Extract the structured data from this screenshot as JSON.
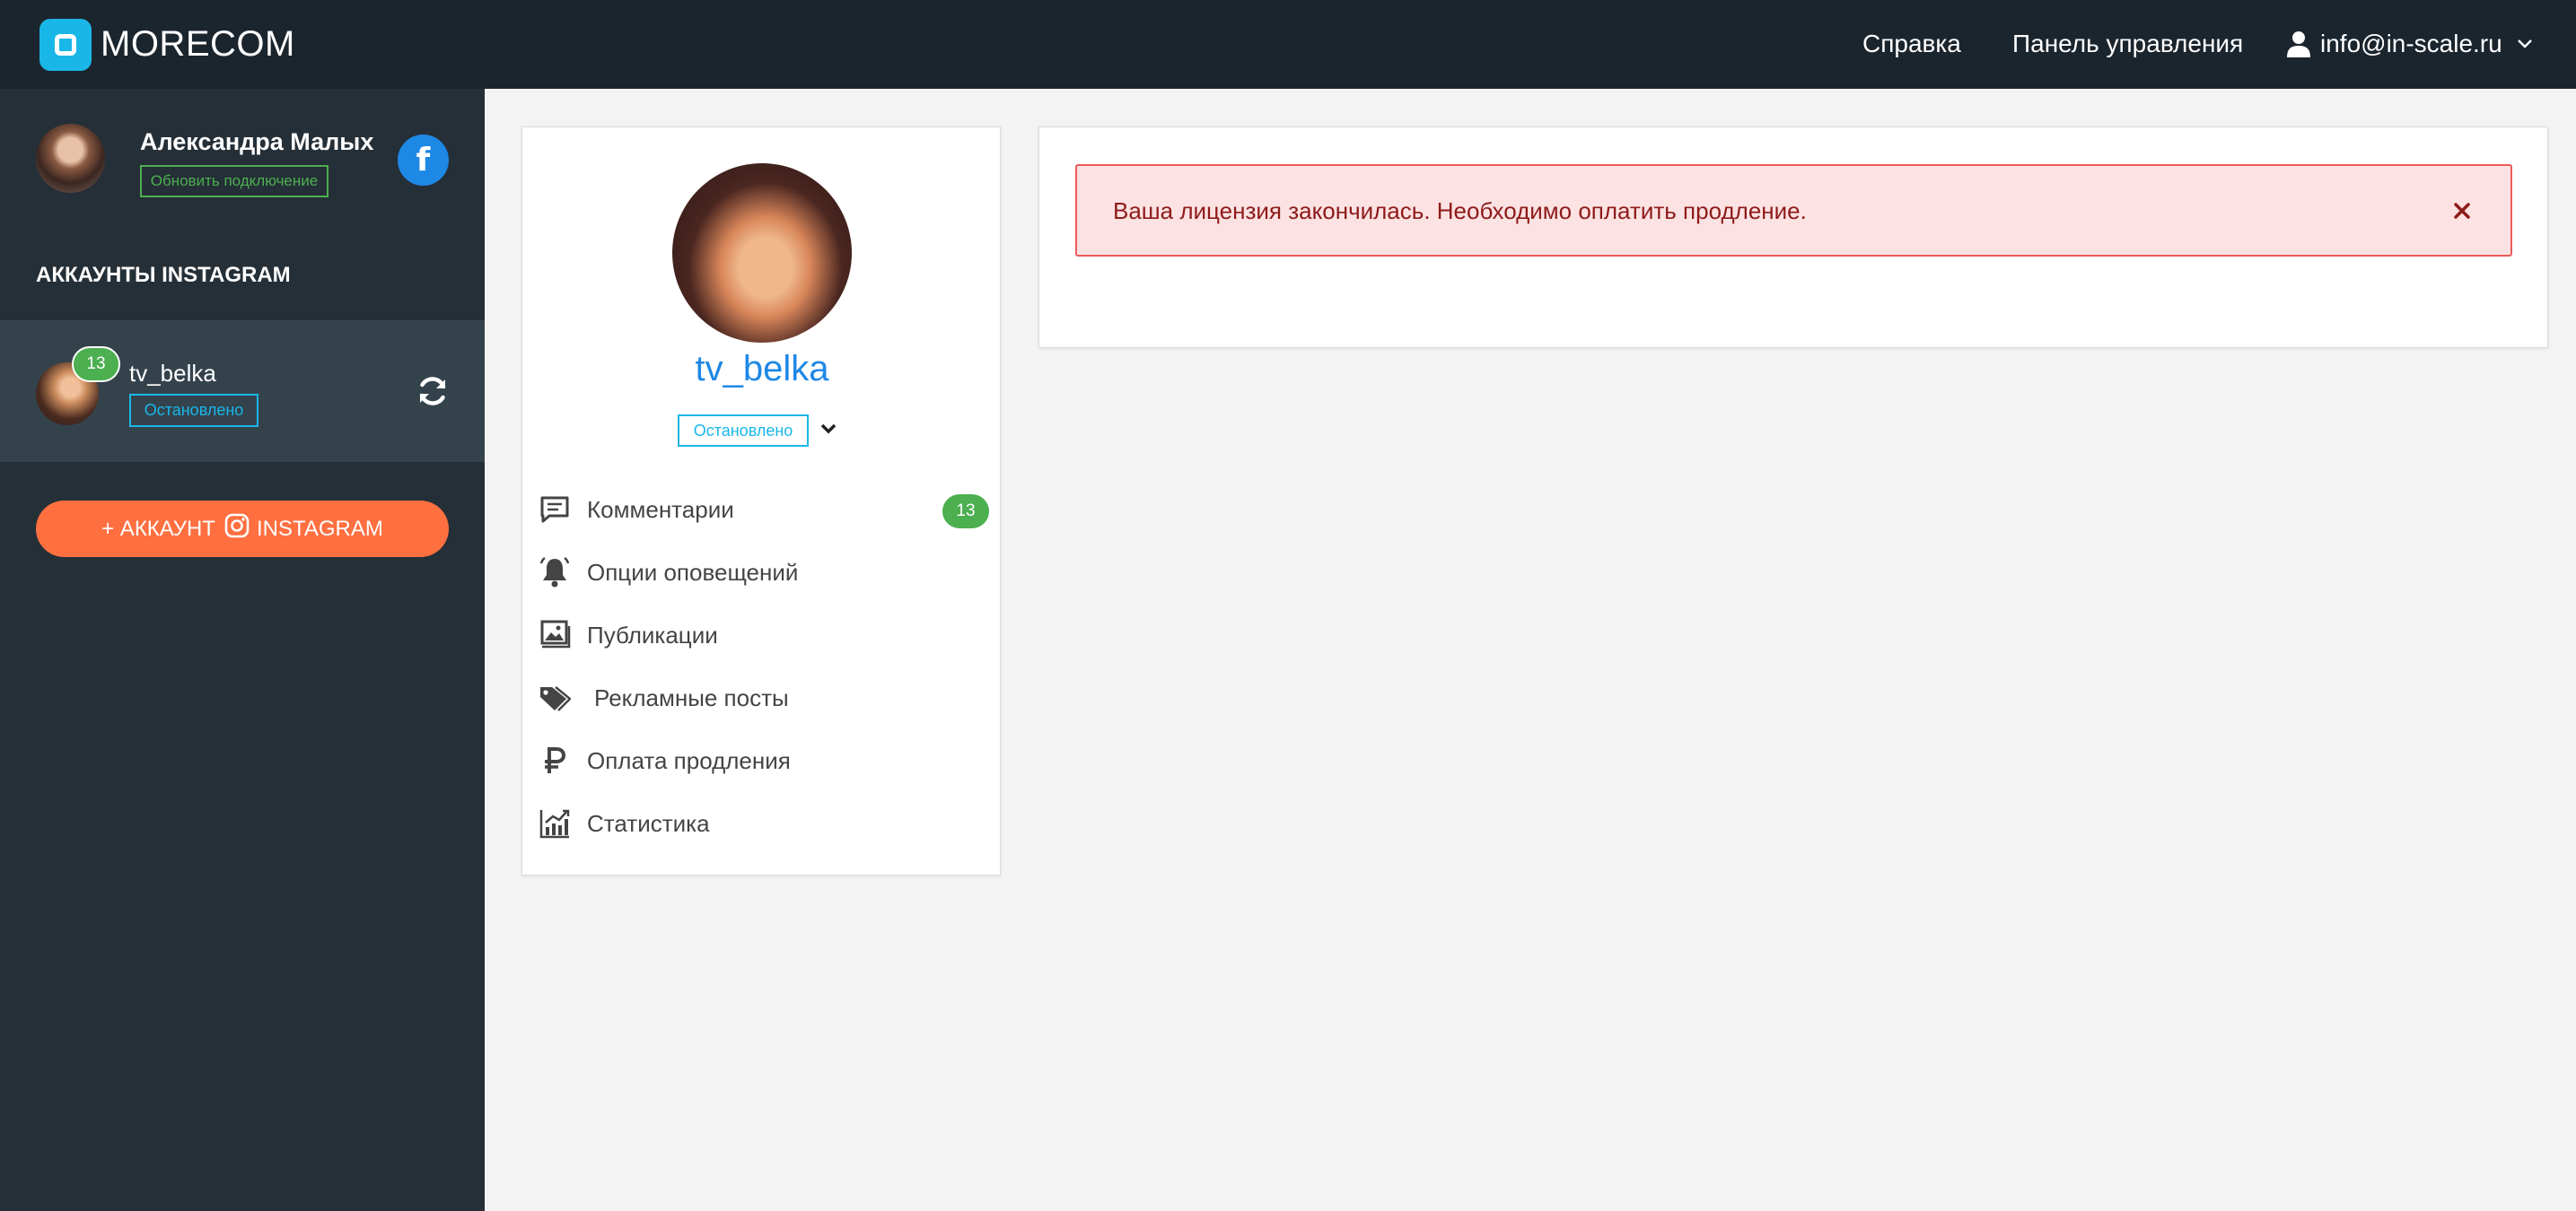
{
  "brand": {
    "name": "MORECOM"
  },
  "topnav": {
    "help": "Справка",
    "panel": "Панель управления",
    "user_email": "info@in-scale.ru"
  },
  "sidebar": {
    "profile_name": "Александра Малых",
    "reconnect_label": "Обновить подключение",
    "fb_label": "f",
    "section_title": "АККАУНТЫ INSTAGRAM",
    "account": {
      "username": "tv_belka",
      "badge": "13",
      "status": "Остановлено"
    },
    "add_button_prefix": "+ АККАУНТ",
    "add_button_suffix": "INSTAGRAM"
  },
  "card": {
    "username": "tv_belka",
    "status": "Остановлено",
    "menu": [
      {
        "label": "Комментарии",
        "icon": "comment-icon",
        "badge": "13"
      },
      {
        "label": "Опции оповещений",
        "icon": "bell-icon"
      },
      {
        "label": "Публикации",
        "icon": "images-icon"
      },
      {
        "label": "Рекламные посты",
        "icon": "tags-icon"
      },
      {
        "label": "Оплата продления",
        "icon": "ruble-icon"
      },
      {
        "label": "Статистика",
        "icon": "chart-icon"
      }
    ]
  },
  "alert": {
    "message": "Ваша лицензия закончилась. Необходимо оплатить продление."
  },
  "colors": {
    "topbar": "#1b252e",
    "sidebar": "#252f37",
    "active_row": "#34424c",
    "accent_blue": "#19b7e8",
    "link_blue": "#1e88e5",
    "success_green": "#4caf50",
    "cta_orange": "#ff6f40",
    "alert_bg": "#fce2e2",
    "alert_border": "#ee5a5a"
  }
}
